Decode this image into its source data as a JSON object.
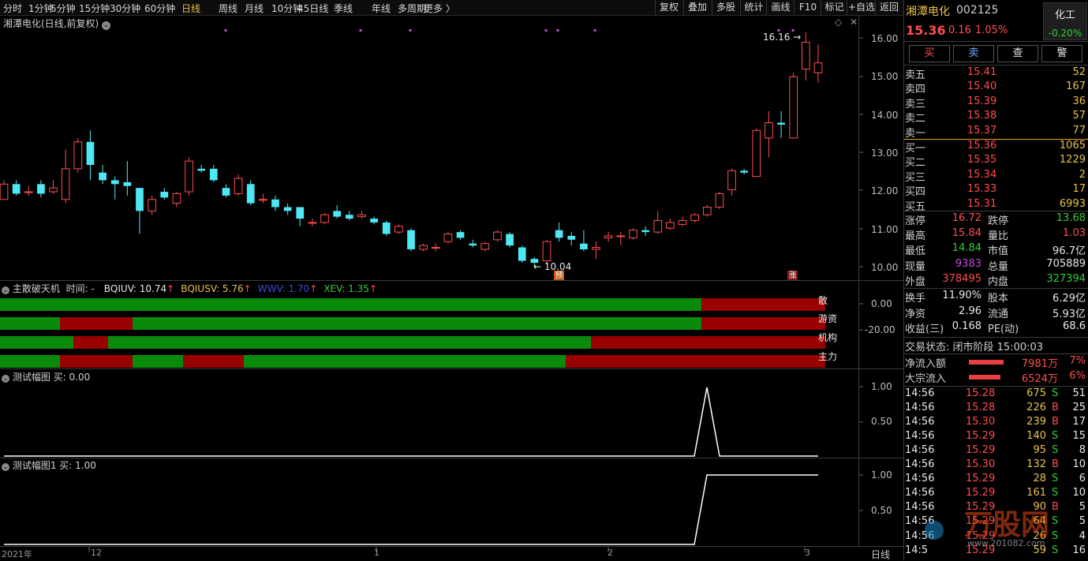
{
  "toolbar": {
    "periods": [
      "分时",
      "1分钟",
      "5分钟",
      "15分钟",
      "30分钟",
      "60分钟",
      "日线",
      "周线",
      "月线",
      "10分钟",
      "45日线",
      "季线",
      "年线",
      "多周期",
      "更多 〉"
    ],
    "active": "日线",
    "right_buttons": [
      "复权",
      "叠加",
      "多股",
      "统计",
      "画线",
      "F10",
      "标记",
      "+自选",
      "返回"
    ]
  },
  "chart": {
    "title": "湘潭电化(日线,前复权)",
    "y_ticks": [
      "16.00",
      "15.00",
      "14.00",
      "13.00",
      "12.00",
      "11.00",
      "10.00"
    ],
    "high_label": "16.16",
    "low_label": "10.04",
    "marker_yu": "预",
    "marker_zhang": "涨"
  },
  "chart_data": {
    "type": "candlestick",
    "ylim": [
      9.8,
      16.3
    ],
    "bars": [
      {
        "o": 11.8,
        "c": 12.2,
        "h": 12.3,
        "l": 11.8
      },
      {
        "o": 12.2,
        "c": 11.95,
        "h": 12.3,
        "l": 11.9
      },
      {
        "o": 12.0,
        "c": 12.0,
        "h": 12.15,
        "l": 11.9
      },
      {
        "o": 12.2,
        "c": 11.95,
        "h": 12.3,
        "l": 11.85
      },
      {
        "o": 12.0,
        "c": 12.1,
        "h": 12.3,
        "l": 11.95
      },
      {
        "o": 11.8,
        "c": 12.6,
        "h": 13.1,
        "l": 11.7
      },
      {
        "o": 12.6,
        "c": 13.3,
        "h": 13.4,
        "l": 12.5
      },
      {
        "o": 13.3,
        "c": 12.7,
        "h": 13.6,
        "l": 12.3
      },
      {
        "o": 12.5,
        "c": 12.3,
        "h": 12.7,
        "l": 12.2
      },
      {
        "o": 12.3,
        "c": 12.2,
        "h": 12.4,
        "l": 11.8
      },
      {
        "o": 12.25,
        "c": 12.15,
        "h": 12.8,
        "l": 11.9
      },
      {
        "o": 12.1,
        "c": 11.5,
        "h": 12.1,
        "l": 10.9
      },
      {
        "o": 11.5,
        "c": 11.8,
        "h": 11.9,
        "l": 11.4
      },
      {
        "o": 12.0,
        "c": 11.85,
        "h": 12.1,
        "l": 11.8
      },
      {
        "o": 11.7,
        "c": 11.95,
        "h": 12.0,
        "l": 11.6
      },
      {
        "o": 12.0,
        "c": 12.8,
        "h": 12.9,
        "l": 11.9
      },
      {
        "o": 12.6,
        "c": 12.55,
        "h": 12.7,
        "l": 12.5
      },
      {
        "o": 12.6,
        "c": 12.3,
        "h": 12.7,
        "l": 12.25
      },
      {
        "o": 12.1,
        "c": 11.9,
        "h": 12.2,
        "l": 11.85
      },
      {
        "o": 11.95,
        "c": 12.35,
        "h": 12.45,
        "l": 11.9
      },
      {
        "o": 12.2,
        "c": 11.7,
        "h": 12.3,
        "l": 11.65
      },
      {
        "o": 11.8,
        "c": 11.8,
        "h": 11.95,
        "l": 11.7
      },
      {
        "o": 11.8,
        "c": 11.6,
        "h": 11.9,
        "l": 11.5
      },
      {
        "o": 11.6,
        "c": 11.5,
        "h": 11.7,
        "l": 11.4
      },
      {
        "o": 11.6,
        "c": 11.3,
        "h": 11.6,
        "l": 11.1
      },
      {
        "o": 11.2,
        "c": 11.2,
        "h": 11.3,
        "l": 11.1
      },
      {
        "o": 11.2,
        "c": 11.4,
        "h": 11.45,
        "l": 11.15
      },
      {
        "o": 11.5,
        "c": 11.35,
        "h": 11.65,
        "l": 11.3
      },
      {
        "o": 11.4,
        "c": 11.3,
        "h": 11.5,
        "l": 11.25
      },
      {
        "o": 11.35,
        "c": 11.4,
        "h": 11.5,
        "l": 11.3
      },
      {
        "o": 11.3,
        "c": 11.2,
        "h": 11.35,
        "l": 11.15
      },
      {
        "o": 11.2,
        "c": 10.9,
        "h": 11.25,
        "l": 10.85
      },
      {
        "o": 10.95,
        "c": 11.1,
        "h": 11.15,
        "l": 10.9
      },
      {
        "o": 11.0,
        "c": 10.5,
        "h": 11.05,
        "l": 10.45
      },
      {
        "o": 10.5,
        "c": 10.6,
        "h": 10.65,
        "l": 10.45
      },
      {
        "o": 10.55,
        "c": 10.55,
        "h": 10.65,
        "l": 10.45
      },
      {
        "o": 10.7,
        "c": 10.9,
        "h": 10.95,
        "l": 10.65
      },
      {
        "o": 10.95,
        "c": 10.8,
        "h": 11.0,
        "l": 10.75
      },
      {
        "o": 10.65,
        "c": 10.6,
        "h": 10.75,
        "l": 10.55
      },
      {
        "o": 10.5,
        "c": 10.65,
        "h": 10.7,
        "l": 10.45
      },
      {
        "o": 10.75,
        "c": 10.95,
        "h": 11.0,
        "l": 10.7
      },
      {
        "o": 10.9,
        "c": 10.6,
        "h": 10.95,
        "l": 10.55
      },
      {
        "o": 10.55,
        "c": 10.2,
        "h": 10.6,
        "l": 10.15
      },
      {
        "o": 10.25,
        "c": 10.15,
        "h": 10.3,
        "l": 10.04
      },
      {
        "o": 10.2,
        "c": 10.7,
        "h": 10.75,
        "l": 10.1
      },
      {
        "o": 11.0,
        "c": 10.8,
        "h": 11.2,
        "l": 10.7
      },
      {
        "o": 10.85,
        "c": 10.75,
        "h": 10.95,
        "l": 10.6
      },
      {
        "o": 10.65,
        "c": 10.5,
        "h": 11.0,
        "l": 10.45
      },
      {
        "o": 10.5,
        "c": 10.55,
        "h": 10.7,
        "l": 10.25
      },
      {
        "o": 10.8,
        "c": 10.85,
        "h": 10.95,
        "l": 10.7
      },
      {
        "o": 10.85,
        "c": 10.85,
        "h": 10.95,
        "l": 10.6
      },
      {
        "o": 10.8,
        "c": 11.0,
        "h": 11.05,
        "l": 10.75
      },
      {
        "o": 11.0,
        "c": 10.95,
        "h": 11.1,
        "l": 10.85
      },
      {
        "o": 10.95,
        "c": 11.25,
        "h": 11.5,
        "l": 10.9
      },
      {
        "o": 11.05,
        "c": 11.2,
        "h": 11.3,
        "l": 11.0
      },
      {
        "o": 11.15,
        "c": 11.25,
        "h": 11.35,
        "l": 11.1
      },
      {
        "o": 11.25,
        "c": 11.4,
        "h": 11.45,
        "l": 11.2
      },
      {
        "o": 11.4,
        "c": 11.6,
        "h": 11.65,
        "l": 11.35
      },
      {
        "o": 11.6,
        "c": 11.95,
        "h": 12.0,
        "l": 11.55
      },
      {
        "o": 12.05,
        "c": 12.55,
        "h": 12.6,
        "l": 11.9
      },
      {
        "o": 12.55,
        "c": 12.5,
        "h": 12.6,
        "l": 12.45
      },
      {
        "o": 12.4,
        "c": 13.6,
        "h": 13.65,
        "l": 12.4
      },
      {
        "o": 13.4,
        "c": 13.8,
        "h": 14.1,
        "l": 12.9
      },
      {
        "o": 13.8,
        "c": 13.75,
        "h": 14.1,
        "l": 13.4
      },
      {
        "o": 13.4,
        "c": 15.0,
        "h": 15.1,
        "l": 13.4
      },
      {
        "o": 15.2,
        "c": 15.9,
        "h": 16.16,
        "l": 14.9
      },
      {
        "o": 15.1,
        "c": 15.36,
        "h": 15.84,
        "l": 14.84
      }
    ]
  },
  "indicator": {
    "title": "主散破天机",
    "time_label": "时间: -",
    "vals": [
      {
        "name": "BQIUV",
        "value": "BQIUV: 10.74",
        "color": "#e8e8e8"
      },
      {
        "name": "BQIUSV",
        "value": "BQIUSV: 5.76",
        "color": "#e8c24a"
      },
      {
        "name": "WWV",
        "value": "WWV: 1.70",
        "color": "#3a4bd6"
      },
      {
        "name": "XEV",
        "value": "XEV: 1.35",
        "color": "#33cc33"
      }
    ],
    "row_labels": [
      "散",
      "游资",
      "机构",
      "主力"
    ],
    "y_ticks": [
      "0.00",
      "-20.00"
    ]
  },
  "sub1": {
    "title": "测试幅图",
    "value": "买: 0.00",
    "y_ticks": [
      "1.00",
      "0.50"
    ]
  },
  "sub2": {
    "title": "测试幅图1",
    "value": "买: 1.00",
    "y_ticks": [
      "1.00",
      "0.50"
    ]
  },
  "xaxis": {
    "labels": [
      "2021年",
      "12",
      "1",
      "2",
      "3"
    ],
    "period": "日线"
  },
  "right": {
    "name": "湘潭电化",
    "code": "002125",
    "sector": "化工",
    "sector_change": "-0.20%",
    "price": "15.36",
    "change": "0.16",
    "pct": "1.05%",
    "buttons": [
      "买",
      "卖",
      "查",
      "警"
    ],
    "asks": [
      [
        "卖五",
        "15.41",
        "52"
      ],
      [
        "卖四",
        "15.40",
        "167"
      ],
      [
        "卖三",
        "15.39",
        "36"
      ],
      [
        "卖二",
        "15.38",
        "57"
      ],
      [
        "卖一",
        "15.37",
        "77"
      ]
    ],
    "bids": [
      [
        "买一",
        "15.36",
        "1065"
      ],
      [
        "买二",
        "15.35",
        "1229"
      ],
      [
        "买三",
        "15.34",
        "2"
      ],
      [
        "买四",
        "15.33",
        "17"
      ],
      [
        "买五",
        "15.31",
        "6993"
      ]
    ],
    "stats": [
      [
        "涨停",
        "16.72",
        "跌停",
        "13.68"
      ],
      [
        "最高",
        "15.84",
        "量比",
        "1.03"
      ],
      [
        "最低",
        "14.84",
        "市值",
        "96.7亿"
      ],
      [
        "现量",
        "9383",
        "总量",
        "705889"
      ],
      [
        "外盘",
        "378495",
        "内盘",
        "327394"
      ]
    ],
    "stats2": [
      [
        "换手",
        "11.90%",
        "股本",
        "6.29亿"
      ],
      [
        "净资",
        "2.96",
        "流通",
        "5.93亿"
      ],
      [
        "收益(三)",
        "0.168",
        "PE(动)",
        "68.6"
      ]
    ],
    "status": "交易状态: 闭市阶段 15:00:03",
    "flows": [
      [
        "净流入额",
        "7981万",
        "7%"
      ],
      [
        "大宗流入",
        "6524万",
        "6%"
      ]
    ],
    "ticks": [
      [
        "14:56",
        "15.28",
        "675",
        "S",
        "51"
      ],
      [
        "14:56",
        "15.28",
        "226",
        "B",
        "25"
      ],
      [
        "14:56",
        "15.30",
        "239",
        "B",
        "17"
      ],
      [
        "14:56",
        "15.29",
        "140",
        "S",
        "15"
      ],
      [
        "14:56",
        "15.29",
        "95",
        "S",
        "8"
      ],
      [
        "14:56",
        "15.30",
        "132",
        "B",
        "10"
      ],
      [
        "14:56",
        "15.29",
        "28",
        "S",
        "6"
      ],
      [
        "14:56",
        "15.29",
        "161",
        "S",
        "10"
      ],
      [
        "14:56",
        "15.29",
        "90",
        "B",
        "5"
      ],
      [
        "14:56",
        "15.29",
        "64",
        "S",
        "5"
      ],
      [
        "14:56",
        "15.29",
        "26",
        "S",
        "4"
      ],
      [
        "14:5",
        "15.29",
        "59",
        "S",
        "16"
      ]
    ],
    "watermark": "万股网",
    "watermark_url": "www.201082.com"
  }
}
